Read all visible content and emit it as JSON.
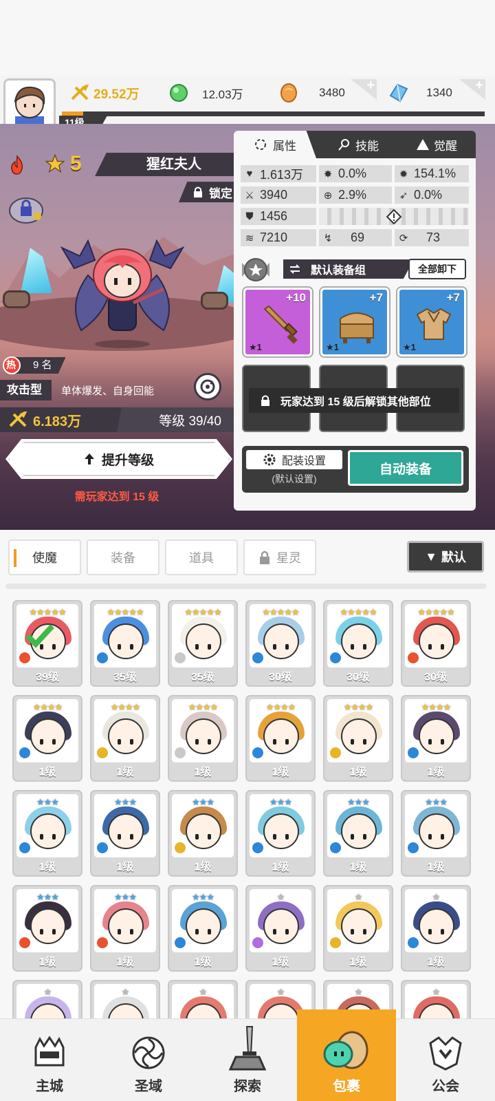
{
  "topbar": {
    "power": "29.52万",
    "gems": "12.03万",
    "coins": "3480",
    "crystals": "1340",
    "player_level": "11级",
    "xp_progress": 0.05
  },
  "hero": {
    "stars": "5",
    "name": "猩红夫人",
    "lock_label": "锁定",
    "rank_prefix": "热",
    "rank": "9 名",
    "type": "攻击型",
    "desc": "单体爆发、自身回能",
    "power": "6.183万",
    "level_text": "等级 39/40",
    "upgrade_label": "提升等级",
    "requirement": "需玩家达到 15 级"
  },
  "panel": {
    "tabs": [
      "属性",
      "技能",
      "觉醒"
    ],
    "stats": {
      "hp": "1.613万",
      "crit": "0.0%",
      "crit_dmg": "154.1%",
      "atk": "3940",
      "hit": "2.9%",
      "dodge": "0.0%",
      "def": "1456",
      "speed": "7210",
      "pierce": "69",
      "resist": "73"
    },
    "set_label": "默认装备组",
    "unequip_label": "全部卸下",
    "equips": [
      {
        "plus": "+10",
        "star": "★1",
        "icon": "sword-icon"
      },
      {
        "plus": "+7",
        "star": "★1",
        "icon": "chest-icon"
      },
      {
        "plus": "+7",
        "star": "★1",
        "icon": "armor-icon"
      }
    ],
    "lock_msg": "玩家达到 15 级后解锁其他部位",
    "config_label": "配装设置",
    "config_sub": "(默认设置)",
    "auto_label": "自动装备"
  },
  "categories": [
    "使魔",
    "装备",
    "道具",
    "星灵"
  ],
  "sort_label": "默认",
  "cards": [
    {
      "lv": "39级",
      "stars": "★★★★★",
      "hair": "#ea5a63",
      "el": "#e9512f"
    },
    {
      "lv": "35级",
      "stars": "★★★★★",
      "hair": "#4c8fe0",
      "el": "#2e86d8"
    },
    {
      "lv": "35级",
      "stars": "★★★★★",
      "hair": "#f3f0ea",
      "el": "#c9c9c9"
    },
    {
      "lv": "30级",
      "stars": "★★★★★",
      "hair": "#a9cfe8",
      "el": "#2e86d8"
    },
    {
      "lv": "30级",
      "stars": "★★★★★",
      "hair": "#7bd1e6",
      "el": "#2e86d8"
    },
    {
      "lv": "30级",
      "stars": "★★★★★",
      "hair": "#e2574f",
      "el": "#e9512f"
    },
    {
      "lv": "1级",
      "stars": "★★★★",
      "hair": "#3c3f59",
      "el": "#2e86d8"
    },
    {
      "lv": "1级",
      "stars": "★★★★",
      "hair": "#e9e6e0",
      "el": "#e8b42a"
    },
    {
      "lv": "1级",
      "stars": "★★★★",
      "hair": "#d9c9c6",
      "el": "#c9c9c9"
    },
    {
      "lv": "1级",
      "stars": "★★★★",
      "hair": "#e6a23a",
      "el": "#2e86d8"
    },
    {
      "lv": "1级",
      "stars": "★★★★",
      "hair": "#f2e5cf",
      "el": "#e8b42a"
    },
    {
      "lv": "1级",
      "stars": "★★★★",
      "hair": "#5b4a6e",
      "el": "#2e86d8"
    },
    {
      "lv": "1级",
      "stars": "★★★",
      "hair": "#8dd0ea",
      "el": "#2e86d8"
    },
    {
      "lv": "1级",
      "stars": "★★★",
      "hair": "#3e69a8",
      "el": "#2e86d8"
    },
    {
      "lv": "1级",
      "stars": "★★★",
      "hair": "#c58a4c",
      "el": "#e8b42a"
    },
    {
      "lv": "1级",
      "stars": "★★★",
      "hair": "#7fcbe0",
      "el": "#2e86d8"
    },
    {
      "lv": "1级",
      "stars": "★★★",
      "hair": "#6bb6d8",
      "el": "#2e86d8"
    },
    {
      "lv": "1级",
      "stars": "★★★",
      "hair": "#7fb6d6",
      "el": "#2e86d8"
    },
    {
      "lv": "1级",
      "stars": "★★★",
      "hair": "#3a2f3e",
      "el": "#e9512f"
    },
    {
      "lv": "1级",
      "stars": "★★★",
      "hair": "#e7838c",
      "el": "#e9512f"
    },
    {
      "lv": "1级",
      "stars": "★★★",
      "hair": "#5aa3d6",
      "el": "#2e86d8"
    },
    {
      "lv": "1级",
      "stars": "★",
      "hair": "#8e6fc4",
      "el": "#b26be0"
    },
    {
      "lv": "1级",
      "stars": "★",
      "hair": "#f2c85b",
      "el": "#e8b42a"
    },
    {
      "lv": "1级",
      "stars": "★",
      "hair": "#3a4d86",
      "el": "#2e86d8"
    },
    {
      "lv": "",
      "stars": "★",
      "hair": "#c7b4ea",
      "el": "#b26be0"
    },
    {
      "lv": "",
      "stars": "★",
      "hair": "#e0e0e0",
      "el": "#c9c9c9"
    },
    {
      "lv": "",
      "stars": "★",
      "hair": "#e57a6f",
      "el": "#e9512f"
    },
    {
      "lv": "",
      "stars": "★",
      "hair": "#e47a6f",
      "el": "#e9512f"
    },
    {
      "lv": "",
      "stars": "★",
      "hair": "#c86a5d",
      "el": "#e9512f"
    },
    {
      "lv": "",
      "stars": "★",
      "hair": "#e06a64",
      "el": "#e9512f"
    }
  ],
  "nav": [
    {
      "label": "主城",
      "icon": "castle-icon"
    },
    {
      "label": "圣域",
      "icon": "vortex-icon"
    },
    {
      "label": "探索",
      "icon": "sword-stone-icon"
    },
    {
      "label": "包裹",
      "icon": "bag-icon"
    },
    {
      "label": "公会",
      "icon": "guild-icon"
    }
  ],
  "colors": {
    "accent": "#f5a622",
    "teal": "#2ea796",
    "dark": "#3b3b3b",
    "warning": "#ff5a43"
  }
}
